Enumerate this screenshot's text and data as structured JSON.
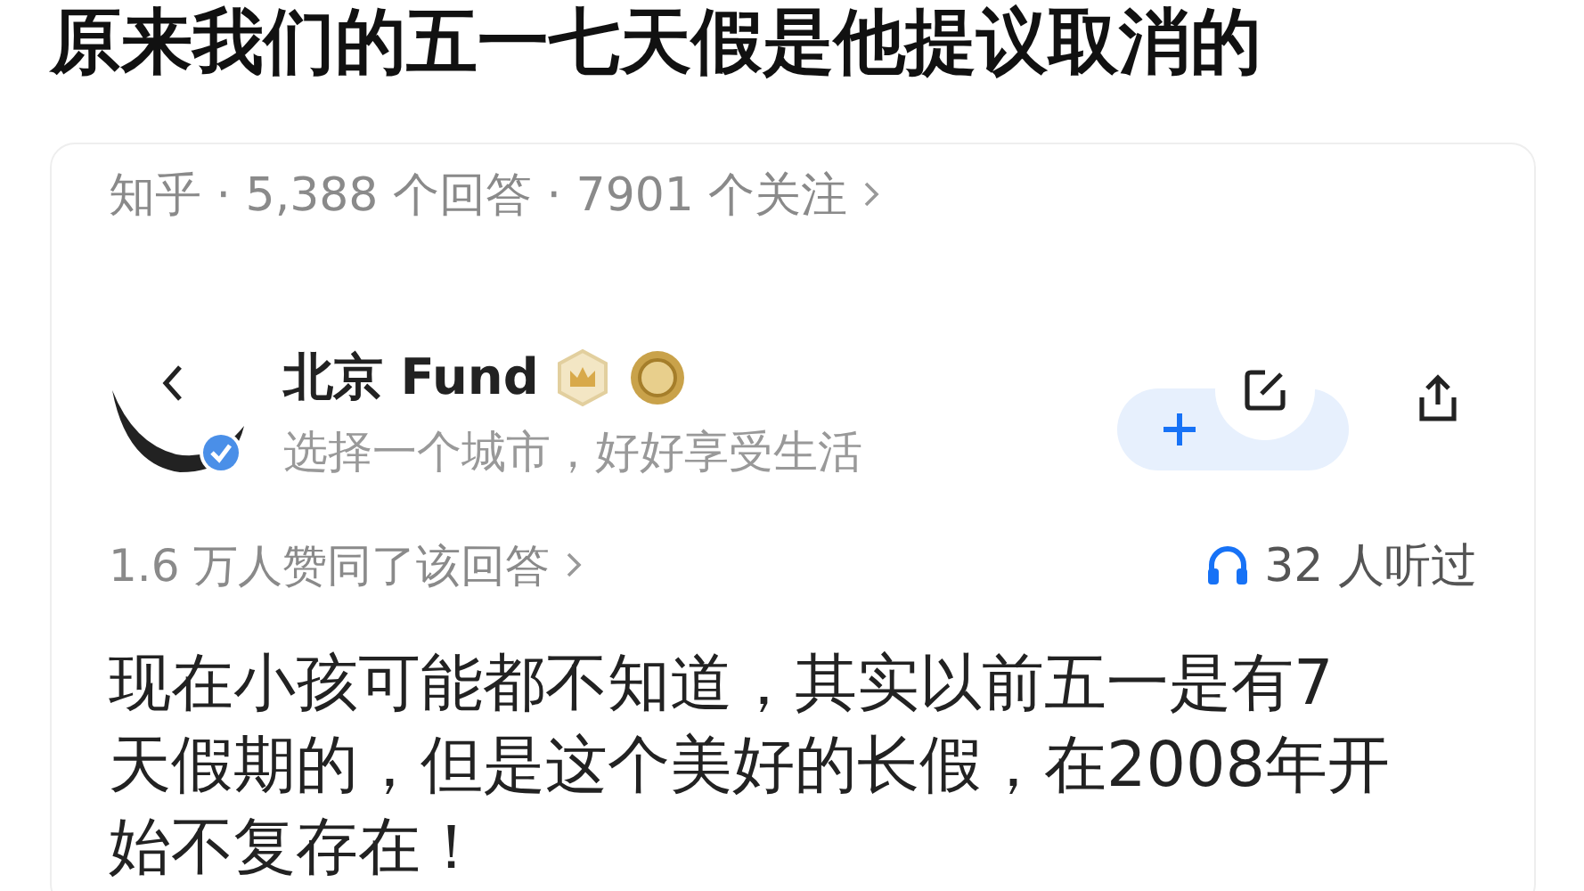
{
  "title": "原来我们的五一七天假是他提议取消的",
  "question_meta": {
    "text": "知乎 · 5,388 个回答 · 7901 个关注"
  },
  "author": {
    "name": "北京 Fund",
    "bio": "选择一个城市，好好享受生活"
  },
  "stats": {
    "likes": "1.6 万人赞同了该回答",
    "listens": "32 人听过"
  },
  "answer": {
    "text": "现在小孩可能都不知道，其实以前五一是有7天假期的，但是这个美好的长假，在2008年开始不复存在！"
  }
}
